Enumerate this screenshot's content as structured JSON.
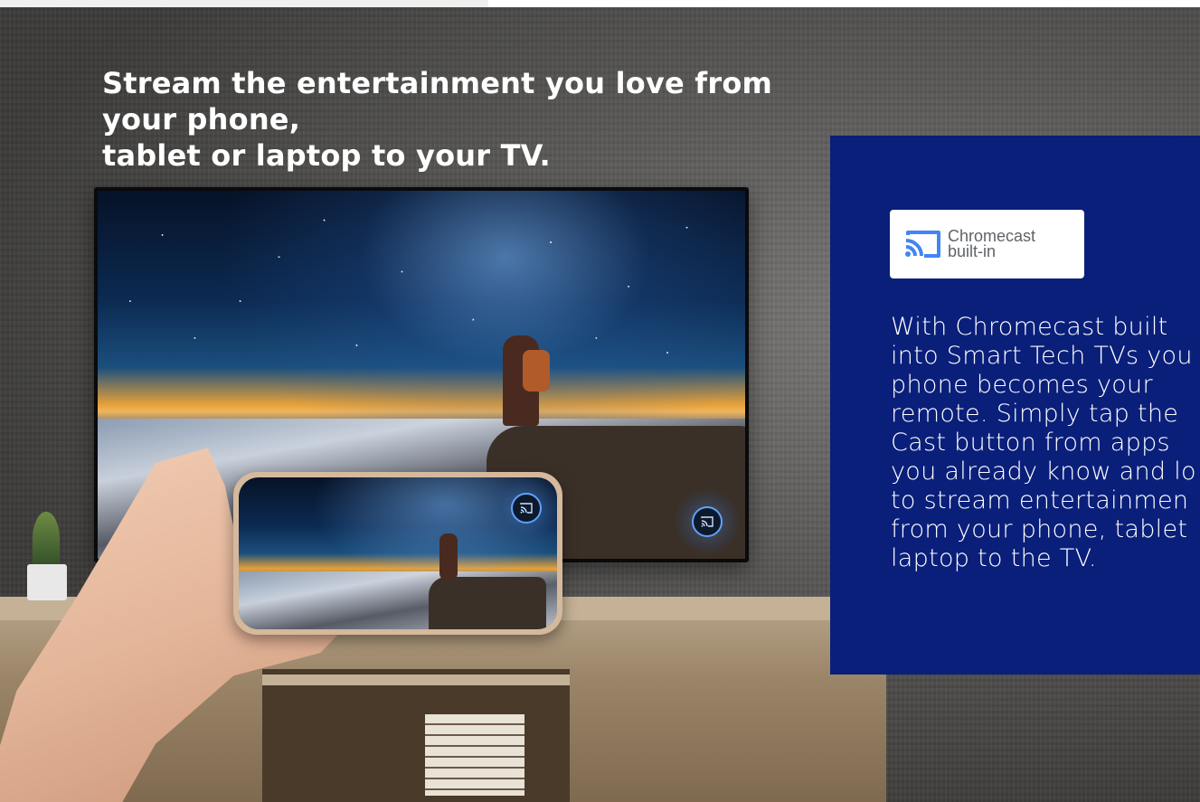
{
  "headline": {
    "line1": "Stream the entertainment you love from your phone,",
    "line2": "tablet or laptop to your TV."
  },
  "panel": {
    "badge_line1": "Chromecast",
    "badge_line2": "built-in",
    "body_lines": [
      "With Chromecast built",
      "into Smart Tech TVs you",
      "phone becomes your",
      "remote. Simply tap the",
      "Cast button from apps",
      "you already know and lo",
      "to stream entertainmen",
      "from your phone, tablet",
      "laptop to the TV."
    ]
  },
  "icons": {
    "badge": "chromecast-logo-icon",
    "tv_cast": "cast-icon",
    "phone_cast": "cast-icon"
  },
  "colors": {
    "panel_bg": "#0a1f7a",
    "headline": "#ffffff",
    "cast_accent": "#5fa2ff",
    "chromecast_blue": "#4285f4"
  }
}
